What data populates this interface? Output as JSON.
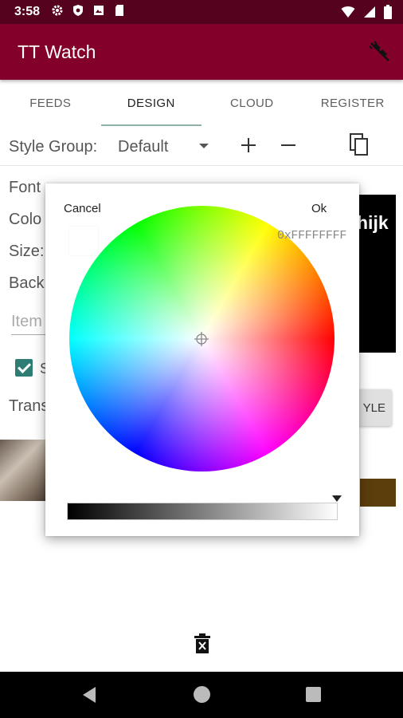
{
  "status_bar": {
    "time": "3:58",
    "icons_left": [
      "settings-icon",
      "shield-icon",
      "image-icon",
      "sd-card-icon"
    ],
    "icons_right": [
      "wifi-icon",
      "signal-icon",
      "battery-icon"
    ]
  },
  "app_bar": {
    "title": "TT Watch",
    "action_icon": "connection-plug-icon",
    "color": "#83002b"
  },
  "tabs": [
    {
      "label": "FEEDS",
      "active": false
    },
    {
      "label": "DESIGN",
      "active": true
    },
    {
      "label": "CLOUD",
      "active": false
    },
    {
      "label": "REGISTER",
      "active": false
    }
  ],
  "style_group": {
    "label": "Style Group:",
    "value": "Default"
  },
  "background_rows": [
    {
      "label": "Font"
    },
    {
      "label": "Colo"
    },
    {
      "label": "Size:"
    },
    {
      "label": "Back"
    }
  ],
  "item_placeholder": "Item",
  "checkbox_label": "S",
  "trans_label": "Trans",
  "preview_text": "hijk",
  "style_button": "YLE",
  "color_picker": {
    "cancel": "Cancel",
    "ok": "Ok",
    "hex": "0xFFFFFFFF",
    "selected_color": "#FFFFFF"
  },
  "nav_bar": {
    "buttons": [
      "back-icon",
      "home-icon",
      "recents-icon"
    ]
  }
}
